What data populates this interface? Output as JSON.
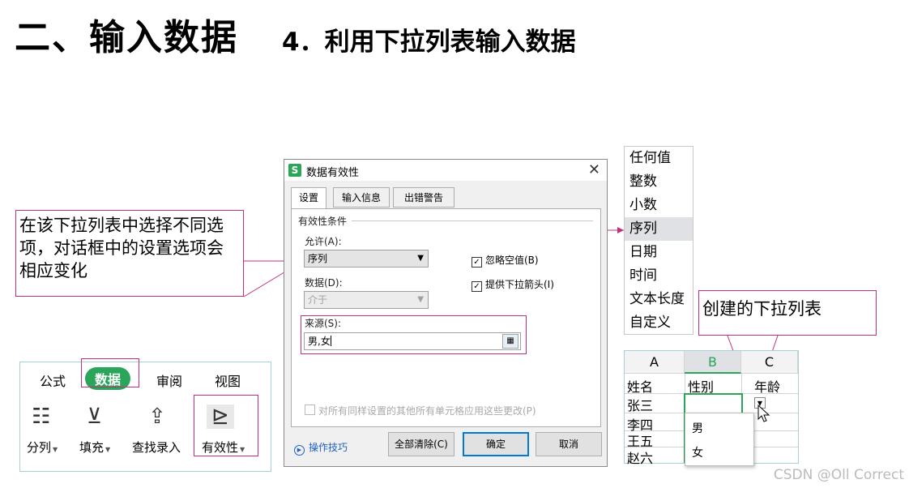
{
  "headings": {
    "main": "二、输入数据",
    "sub": "4．利用下拉列表输入数据"
  },
  "callouts": {
    "left": "在该下拉列表中选择不同选项，对话框中的设置选项会相应变化",
    "right": "创建的下拉列表"
  },
  "dialog": {
    "title": "数据有效性",
    "logo": "S",
    "close": "✕",
    "tabs": [
      "设置",
      "输入信息",
      "出错警告"
    ],
    "section": "有效性条件",
    "allow_label": "允许(A):",
    "allow_value": "序列",
    "data_label": "数据(D):",
    "data_value": "介于",
    "ignore_blank": "忽略空值(B)",
    "in_cell_dropdown": "提供下拉箭头(I)",
    "source_label": "来源(S):",
    "source_value": "男,女",
    "apply_all": "对所有同样设置的其他所有单元格应用这些更改(P)",
    "tips": "操作技巧",
    "clear_all": "全部清除(C)",
    "ok": "确定",
    "cancel": "取消"
  },
  "allow_list": {
    "items": [
      "任何值",
      "整数",
      "小数",
      "序列",
      "日期",
      "时间",
      "文本长度",
      "自定义"
    ],
    "selected_index": 3
  },
  "ribbon": {
    "tabs": [
      "公式",
      "数据",
      "审阅",
      "视图"
    ],
    "active_tab": "数据",
    "buttons": [
      {
        "label": "分列",
        "icon": "split-columns-icon",
        "has_dropdown": true
      },
      {
        "label": "填充",
        "icon": "fill-icon",
        "has_dropdown": true
      },
      {
        "label": "查找录入",
        "icon": "lookup-entry-icon",
        "has_dropdown": false
      },
      {
        "label": "有效性",
        "icon": "validation-icon",
        "has_dropdown": true
      }
    ]
  },
  "sheet": {
    "columns": [
      "A",
      "B",
      "C"
    ],
    "selected_column": "B",
    "header_row": [
      "姓名",
      "性别",
      "年龄"
    ],
    "names": [
      "张三",
      "李四",
      "王五",
      "赵六"
    ],
    "dropdown_options": [
      "男",
      "女"
    ]
  },
  "watermark": "CSDN @Oll Correct",
  "colors": {
    "accent_green": "#2aa55a",
    "callout_magenta": "#c0307a",
    "focus_blue": "#0078d7"
  }
}
